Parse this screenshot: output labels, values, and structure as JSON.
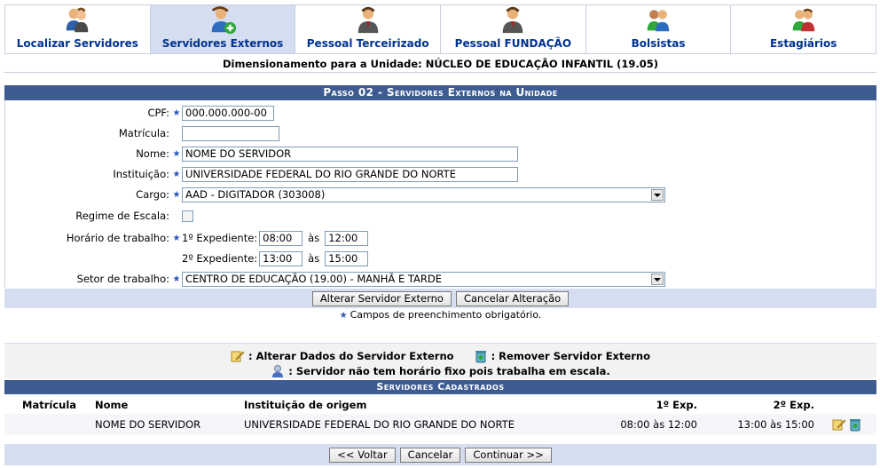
{
  "tabs": [
    {
      "label": "Localizar Servidores",
      "icon": "users-search-icon",
      "active": false
    },
    {
      "label": "Servidores Externos",
      "icon": "user-add-icon",
      "active": true
    },
    {
      "label": "Pessoal Terceirizado",
      "icon": "user-suit-icon",
      "active": false
    },
    {
      "label": "Pessoal FUNDAÇÃO",
      "icon": "user-suit-icon",
      "active": false
    },
    {
      "label": "Bolsistas",
      "icon": "users-green-icon",
      "active": false
    },
    {
      "label": "Estagiários",
      "icon": "users-group-icon",
      "active": false
    }
  ],
  "dimension_text": "Dimensionamento para a Unidade: NÚCLEO DE EDUCAÇÃO INFANTIL (19.05)",
  "form": {
    "title": "Passo 02 - Servidores Externos na Unidade",
    "cpf_label": "CPF:",
    "cpf_value": "000.000.000-00",
    "matricula_label": "Matrícula:",
    "matricula_value": "",
    "nome_label": "Nome:",
    "nome_value": "NOME DO SERVIDOR",
    "instituicao_label": "Instituição:",
    "instituicao_value": "UNIVERSIDADE FEDERAL DO RIO GRANDE DO NORTE",
    "cargo_label": "Cargo:",
    "cargo_value": "AAD - DIGITADOR (303008)",
    "regime_label": "Regime de Escala:",
    "horario_label": "Horário de trabalho:",
    "exp1_label": "1º Expediente:",
    "exp1_start": "08:00",
    "exp1_end": "12:00",
    "exp2_label": "2º Expediente:",
    "exp2_start": "13:00",
    "exp2_end": "15:00",
    "as_label": "às",
    "setor_label": "Setor de trabalho:",
    "setor_value": "CENTRO DE EDUCAÇÃO (19.00) - MANHÃ E TARDE",
    "btn_alterar": "Alterar Servidor Externo",
    "btn_cancelar_alteracao": "Cancelar Alteração",
    "required_note": "Campos de preenchimento obrigatório."
  },
  "legend": {
    "alterar": ": Alterar Dados do Servidor Externo",
    "remover": ": Remover Servidor Externo",
    "escala": ": Servidor não tem horário fixo pois trabalha em escala."
  },
  "table": {
    "title": "Servidores Cadastrados",
    "headers": [
      "Matrícula",
      "Nome",
      "Instituição de origem",
      "1º Exp.",
      "2º Exp."
    ],
    "rows": [
      {
        "matricula": "",
        "nome": "NOME DO SERVIDOR",
        "instituicao": "UNIVERSIDADE FEDERAL DO RIO GRANDE DO NORTE",
        "exp1": "08:00 às 12:00",
        "exp2": "13:00 às 15:00"
      }
    ]
  },
  "footer": {
    "voltar": "<< Voltar",
    "cancelar": "Cancelar",
    "continuar": "Continuar >>"
  },
  "colors": {
    "header_blue": "#3e5c92",
    "tab_text": "#003390",
    "bar_bg": "#d5ddf0"
  }
}
